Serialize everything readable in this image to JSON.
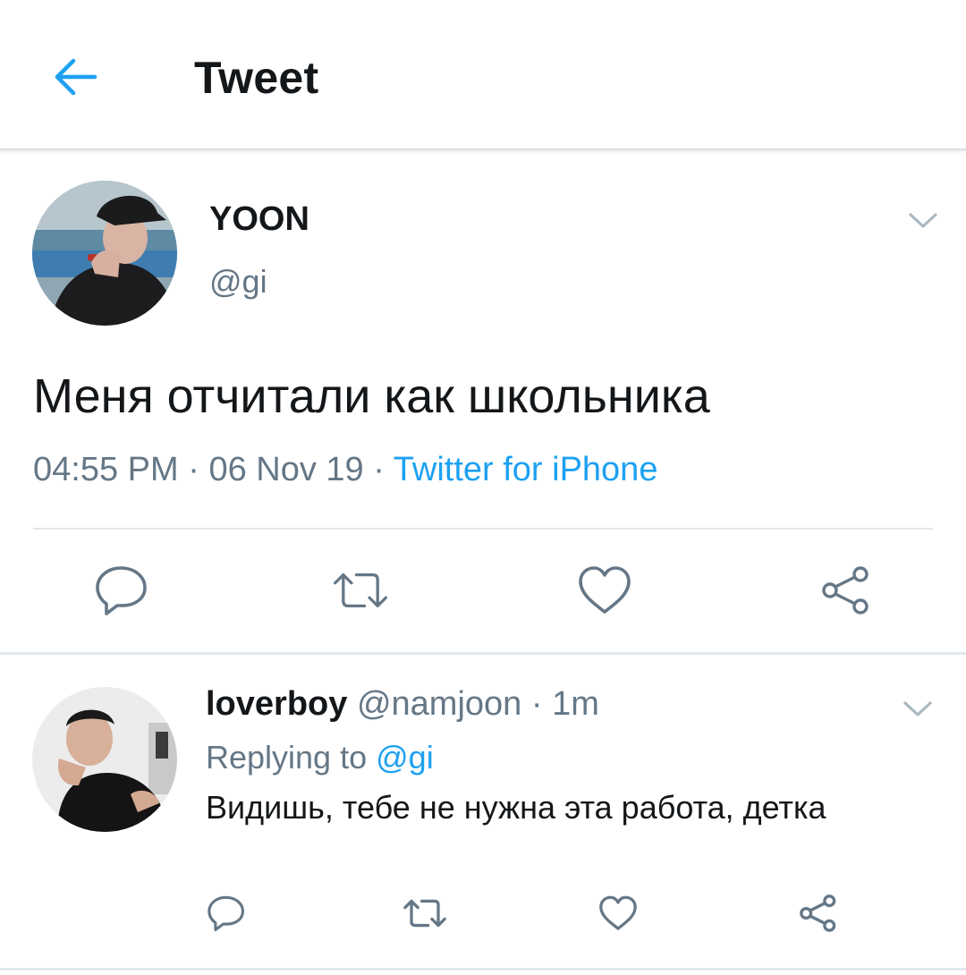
{
  "header": {
    "title": "Tweet",
    "back_icon": "arrow-left-icon",
    "accent": "#1da1f2"
  },
  "tweet": {
    "author_name": "YOON",
    "author_handle": "@gi",
    "text": "Меня отчитали как школьника",
    "time": "04:55 PM",
    "date": "06 Nov 19",
    "source": "Twitter for iPhone",
    "actions": [
      "reply-icon",
      "retweet-icon",
      "like-icon",
      "share-icon"
    ]
  },
  "reply": {
    "author_name": "loverboy",
    "author_handle": "@namjoon",
    "age": "1m",
    "replying_label": "Replying to",
    "replying_to": "@gi",
    "text": "Видишь, тебе не нужна эта работа, детка",
    "actions": [
      "reply-icon",
      "retweet-icon",
      "like-icon",
      "share-icon"
    ]
  },
  "colors": {
    "text_primary": "#14171a",
    "text_secondary": "#657786",
    "link": "#1da1f2",
    "divider": "#e1e8ed"
  }
}
